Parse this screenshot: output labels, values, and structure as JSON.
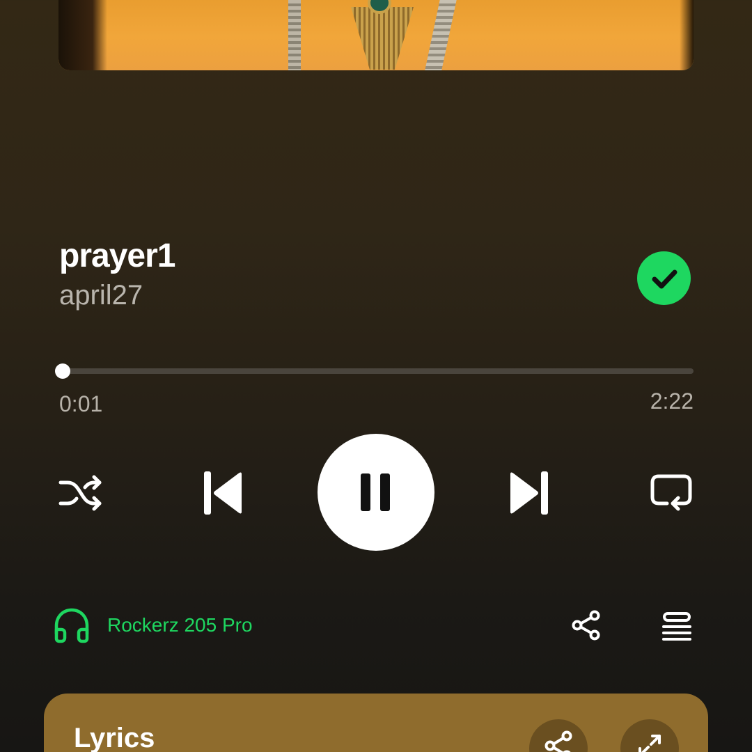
{
  "track": {
    "title": "prayer1",
    "artist": "april27",
    "liked": true
  },
  "playback": {
    "elapsed": "0:01",
    "duration": "2:22",
    "progress_fraction": 0.007,
    "state": "playing"
  },
  "controls": {
    "shuffle_icon": "shuffle-icon",
    "previous_icon": "skip-previous-icon",
    "pause_icon": "pause-icon",
    "next_icon": "skip-next-icon",
    "repeat_icon": "repeat-icon"
  },
  "device": {
    "name": "Rockerz 205 Pro",
    "icon": "headphones-icon"
  },
  "actions": {
    "share_icon": "share-icon",
    "queue_icon": "queue-icon"
  },
  "lyrics": {
    "title": "Lyrics"
  },
  "colors": {
    "accent": "#1ed760",
    "lyrics_card": "#8f6c2d",
    "background_top": "#332815",
    "background_bottom": "#171614"
  }
}
